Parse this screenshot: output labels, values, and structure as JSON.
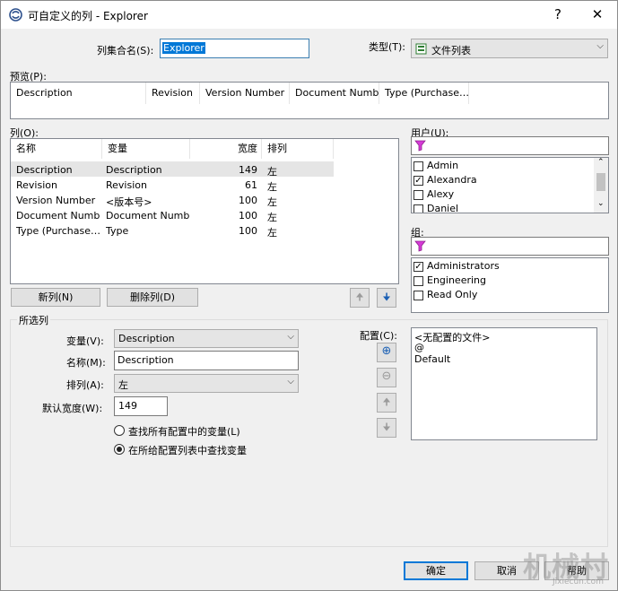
{
  "window": {
    "title": "可自定义的列 - Explorer",
    "help_glyph": "?",
    "close_glyph": "✕"
  },
  "top": {
    "setname_label": "列集合名(S):",
    "setname_value": "Explorer",
    "type_label": "类型(T):",
    "type_value": "文件列表"
  },
  "preview": {
    "label": "预览(P):",
    "columns": [
      "Description",
      "Revision",
      "Version Number",
      "Document Number",
      "Type (Purchase…"
    ]
  },
  "columns": {
    "label": "列(O):",
    "headers": [
      "名称",
      "变量",
      "宽度",
      "排列"
    ],
    "rows": [
      {
        "name": "Description",
        "var": "Description",
        "width": "149",
        "align": "左"
      },
      {
        "name": "Revision",
        "var": "Revision",
        "width": "61",
        "align": "左"
      },
      {
        "name": "Version Number",
        "var": "<版本号>",
        "width": "100",
        "align": "左"
      },
      {
        "name": "Document Number",
        "var": "Document Number",
        "width": "100",
        "align": "左"
      },
      {
        "name": "Type (Purchase…",
        "var": "Type",
        "width": "100",
        "align": "左"
      }
    ],
    "new_button": "新列(N)",
    "delete_button": "删除列(D)"
  },
  "users": {
    "label": "用户(U):",
    "items": [
      {
        "label": "Admin",
        "checked": false
      },
      {
        "label": "Alexandra",
        "checked": true
      },
      {
        "label": "Alexy",
        "checked": false
      },
      {
        "label": "Daniel",
        "checked": false
      }
    ]
  },
  "groups": {
    "label": "组:",
    "items": [
      {
        "label": "Administrators",
        "checked": true
      },
      {
        "label": "Engineering",
        "checked": false
      },
      {
        "label": "Read Only",
        "checked": false
      }
    ]
  },
  "selected": {
    "section_label": "所选列",
    "var_label": "变量(V):",
    "var_value": "Description",
    "name_label": "名称(M):",
    "name_value": "Description",
    "align_label": "排列(A):",
    "align_value": "左",
    "width_label": "默认宽度(W):",
    "width_value": "149",
    "radio1": "查找所有配置中的变量(L)",
    "radio2": "在所给配置列表中查找变量",
    "config_label": "配置(C):",
    "configs": [
      "<无配置的文件>",
      "@",
      "Default"
    ]
  },
  "footer": {
    "ok": "确定",
    "cancel": "取消",
    "help": "帮助"
  },
  "watermark": {
    "main": "机械村",
    "sub": "Jixiecun.com"
  }
}
